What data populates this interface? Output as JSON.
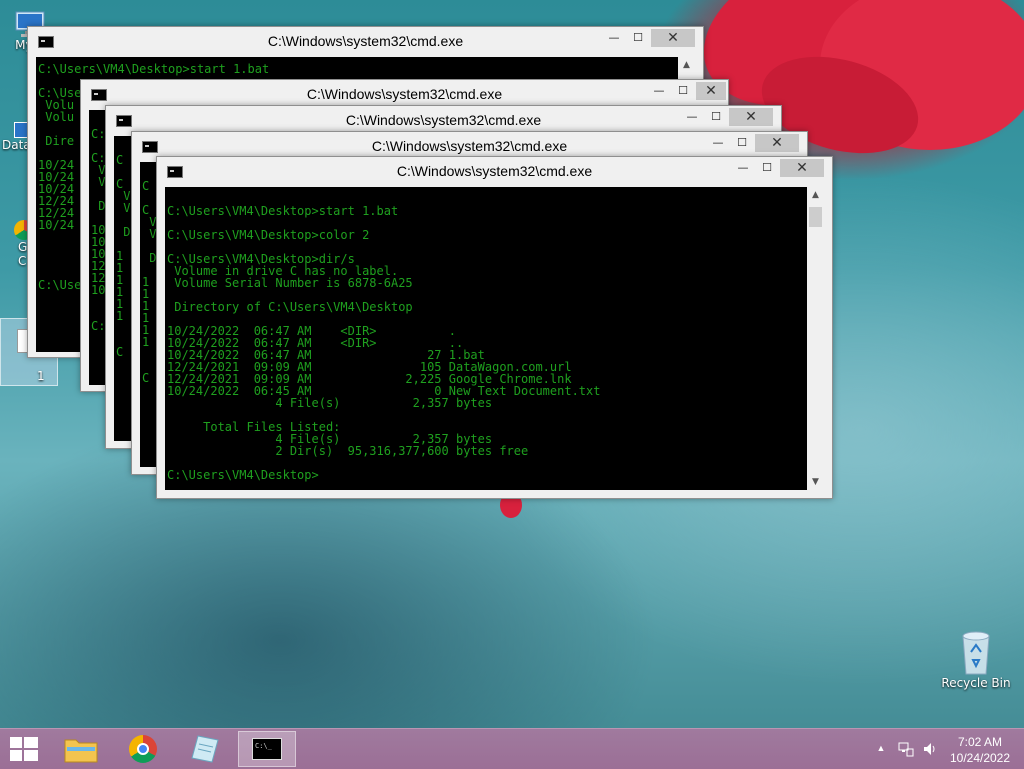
{
  "desktop": {
    "icons": [
      {
        "label": "My C"
      },
      {
        "label": "Data"
      },
      {
        "label": "G"
      },
      {
        "label": "C"
      },
      {
        "label": "1"
      }
    ],
    "recycle_bin_label": "Recycle Bin"
  },
  "windows": [
    {
      "title": "C:\\Windows\\system32\\cmd.exe",
      "console": "C:\\Users\\VM4\\Desktop>start 1.bat\n\nC:\\Use\n Volu\n Volu\n\n Dire\n\n10/24\n10/24\n10/24\n12/24\n12/24\n10/24\n\n\n\n\nC:\\Use"
    },
    {
      "title": "C:\\Windows\\system32\\cmd.exe",
      "console": "\nC:\n\nC:\n V\n V\n\n D\n\n10\n10\n10\n12\n12\n10\n\n\nC:"
    },
    {
      "title": "C:\\Windows\\system32\\cmd.exe",
      "console": "\nC\n\nC\n V\n V\n\n D\n\n1\n1\n1\n1\n1\n1\n\n\nC"
    },
    {
      "title": "C:\\Windows\\system32\\cmd.exe",
      "console": "\nC\n\nC\n V\n V\n\n D\n\n1\n1\n1\n1\n1\n1\n\n\nC"
    },
    {
      "title": "C:\\Windows\\system32\\cmd.exe",
      "console": "\nC:\\Users\\VM4\\Desktop>start 1.bat\n\nC:\\Users\\VM4\\Desktop>color 2\n\nC:\\Users\\VM4\\Desktop>dir/s\n Volume in drive C has no label.\n Volume Serial Number is 6878-6A25\n\n Directory of C:\\Users\\VM4\\Desktop\n\n10/24/2022  06:47 AM    <DIR>          .\n10/24/2022  06:47 AM    <DIR>          ..\n10/24/2022  06:47 AM                27 1.bat\n12/24/2021  09:09 AM               105 DataWagon.com.url\n12/24/2021  09:09 AM             2,225 Google Chrome.lnk\n10/24/2022  06:45 AM                 0 New Text Document.txt\n               4 File(s)          2,357 bytes\n\n     Total Files Listed:\n               4 File(s)          2,357 bytes\n               2 Dir(s)  95,316,377,600 bytes free\n\nC:\\Users\\VM4\\Desktop>"
    }
  ],
  "window_controls": {
    "minimize": "—",
    "maximize": "☐",
    "close": "✕"
  },
  "taskbar": {
    "clock_time": "7:02 AM",
    "clock_date": "10/24/2022",
    "tray_chevron": "▲"
  },
  "colors": {
    "console_text": "#1fa01f",
    "taskbar": "#9b6f96"
  }
}
